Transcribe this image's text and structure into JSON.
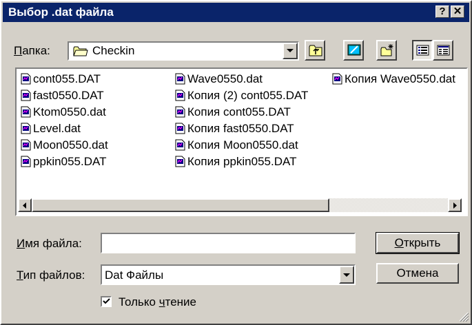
{
  "window": {
    "title": "Выбор .dat файла",
    "help_glyph": "?",
    "close_glyph": "✕"
  },
  "lookin": {
    "label_u": "П",
    "label_rest": "апка:",
    "value": "Checkin"
  },
  "files": {
    "col1": [
      "cont055.DAT",
      "fast0550.DAT",
      "Ktom0550.dat",
      "Level.dat",
      "Moon0550.dat",
      "ppkin055.DAT"
    ],
    "col2": [
      "Wave0550.dat",
      "Копия (2) cont055.DAT",
      "Копия cont055.DAT",
      "Копия fast0550.DAT",
      "Копия Moon0550.dat",
      "Копия ppkin055.DAT"
    ],
    "col3": [
      "Копия Wave0550.dat"
    ]
  },
  "filename": {
    "label_u": "И",
    "label_rest": "мя файла:",
    "value": ""
  },
  "filetype": {
    "label_u": "Т",
    "label_rest": "ип файлов:",
    "value": "Dat Файлы"
  },
  "buttons": {
    "open_u": "О",
    "open_rest": "ткрыть",
    "cancel": "Отмена"
  },
  "readonly": {
    "checked": true,
    "label_pre": "Только ",
    "label_u": "ч",
    "label_rest": "тение"
  }
}
